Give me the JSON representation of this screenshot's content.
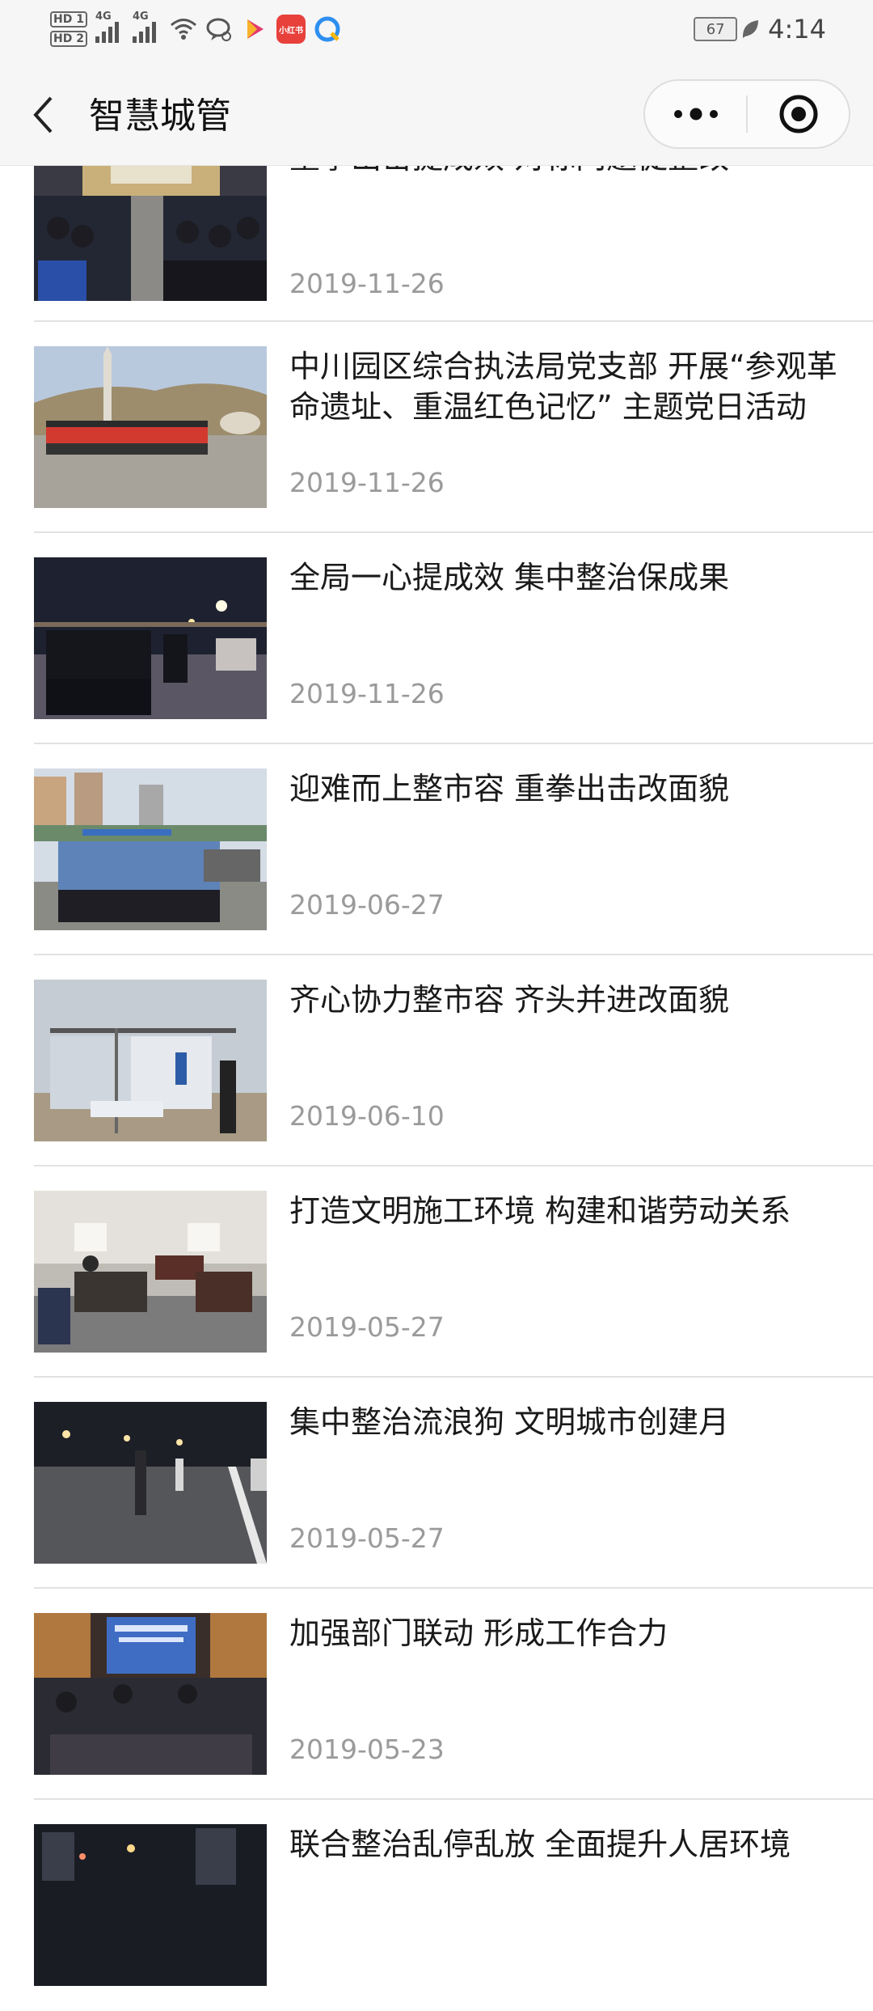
{
  "status_bar": {
    "hd1": "HD 1",
    "hd2": "HD 2",
    "network1": "4G",
    "network2": "4G",
    "battery": "67",
    "time": "4:14",
    "app_badge": "小红书"
  },
  "header": {
    "title": "智慧城管"
  },
  "news": [
    {
      "title": "重拳出击提成效 对标问题促整改",
      "date": "2019-11-26"
    },
    {
      "title": "中川园区综合执法局党支部 开展“参观革命遗址、重温红色记忆” 主题党日活动",
      "date": "2019-11-26"
    },
    {
      "title": "全局一心提成效 集中整治保成果",
      "date": "2019-11-26"
    },
    {
      "title": "迎难而上整市容 重拳出击改面貌",
      "date": "2019-06-27"
    },
    {
      "title": "齐心协力整市容 齐头并进改面貌",
      "date": "2019-06-10"
    },
    {
      "title": "打造文明施工环境 构建和谐劳动关系",
      "date": "2019-05-27"
    },
    {
      "title": "集中整治流浪狗 文明城市创建月",
      "date": "2019-05-27"
    },
    {
      "title": "加强部门联动 形成工作合力",
      "date": "2019-05-23"
    },
    {
      "title": "联合整治乱停乱放 全面提升人居环境",
      "date": ""
    }
  ]
}
